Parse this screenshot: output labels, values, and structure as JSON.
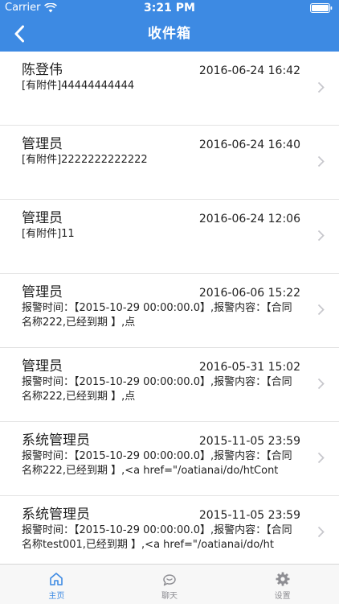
{
  "status_bar": {
    "carrier": "Carrier",
    "time": "3:21 PM"
  },
  "nav": {
    "title": "收件箱"
  },
  "messages": [
    {
      "sender": "陈登伟",
      "date": "2016-06-24 16:42",
      "preview": "[有附件]44444444444"
    },
    {
      "sender": "管理员",
      "date": "2016-06-24 16:40",
      "preview": "[有附件]2222222222222"
    },
    {
      "sender": "管理员",
      "date": "2016-06-24 12:06",
      "preview": "[有附件]11"
    },
    {
      "sender": "管理员",
      "date": "2016-06-06 15:22",
      "preview": "报警时间：【2015-10-29 00:00:00.0】,报警内容：【合同名称222,已经到期 】,点"
    },
    {
      "sender": "管理员",
      "date": "2016-05-31 15:02",
      "preview": "报警时间：【2015-10-29 00:00:00.0】,报警内容：【合同名称222,已经到期 】,点"
    },
    {
      "sender": "系统管理员",
      "date": "2015-11-05 23:59",
      "preview": "报警时间：【2015-10-29 00:00:00.0】,报警内容：【合同名称222,已经到期 】,<a href=\"/oatianai/do/htCont"
    },
    {
      "sender": "系统管理员",
      "date": "2015-11-05 23:59",
      "preview": "报警时间：【2015-10-29 00:00:00.0】,报警内容：【合同名称test001,已经到期 】,<a href=\"/oatianai/do/ht"
    }
  ],
  "tabs": [
    {
      "label": "主页",
      "icon": "home-icon",
      "active": true
    },
    {
      "label": "聊天",
      "icon": "chat-icon",
      "active": false
    },
    {
      "label": "设置",
      "icon": "gear-icon",
      "active": false
    }
  ],
  "colors": {
    "header": "#3d8ae3",
    "tab_active": "#3d8ae3",
    "tab_inactive": "#8e8e93",
    "separator": "#e4e4e4",
    "chevron": "#c7c7cc"
  }
}
